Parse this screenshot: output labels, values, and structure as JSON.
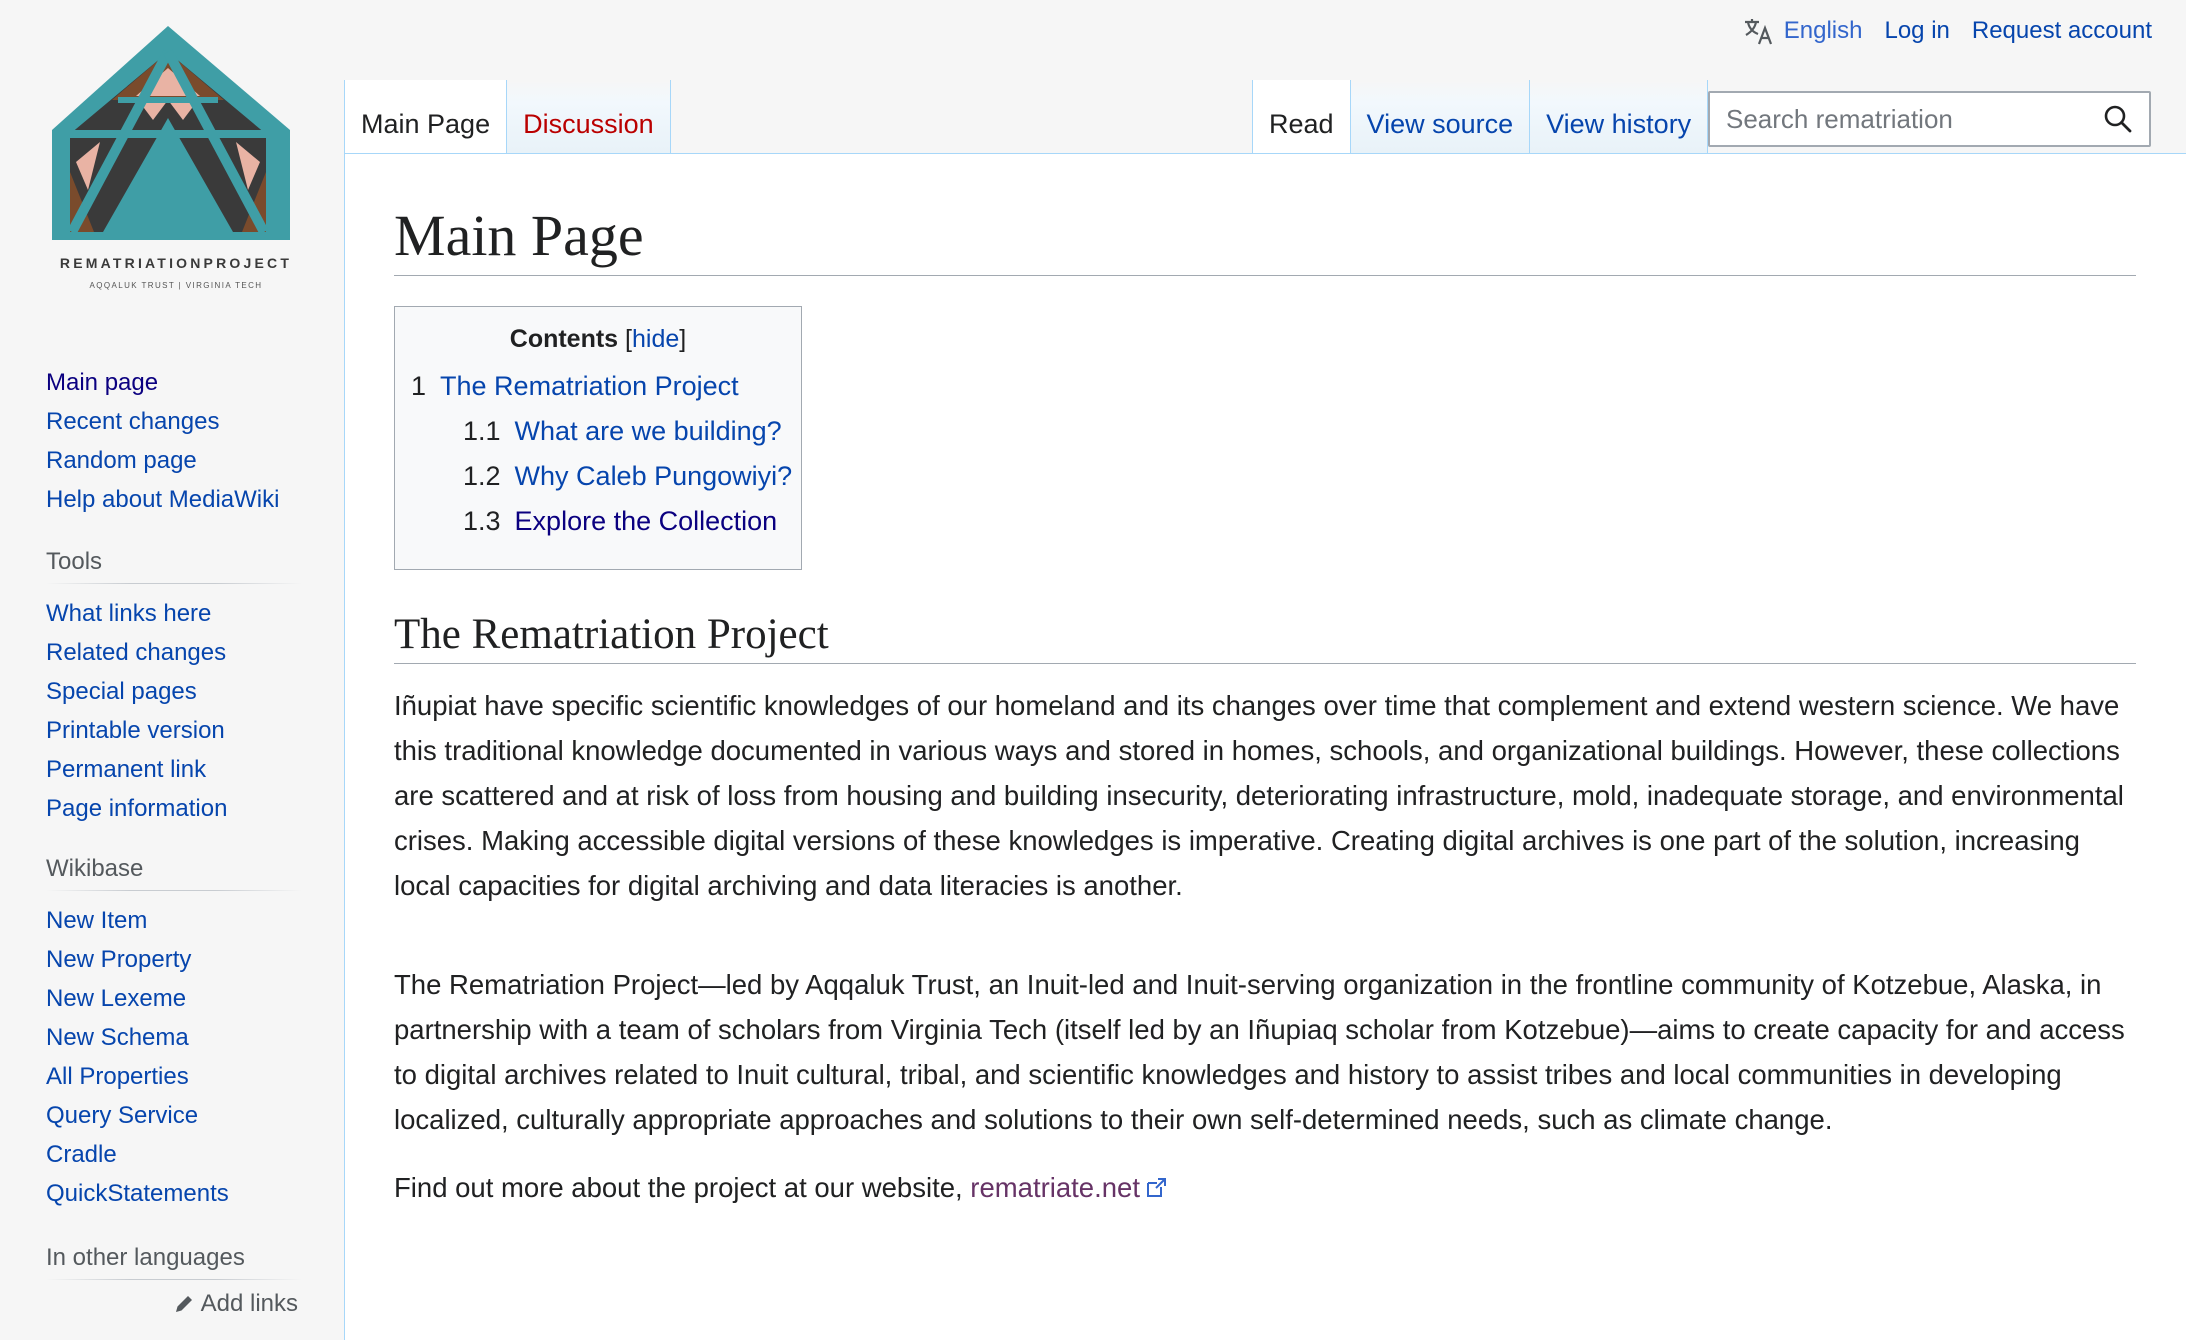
{
  "logo": {
    "wordmark": "REMATRIATIONPROJECT",
    "tagline": "AQQALUK TRUST | VIRGINIA TECH"
  },
  "personal": {
    "language": "English",
    "login": "Log in",
    "request_account": "Request account"
  },
  "tabs": {
    "left": [
      "Main Page",
      "Discussion"
    ],
    "right": [
      "Read",
      "View source",
      "View history"
    ]
  },
  "search": {
    "placeholder": "Search rematriation"
  },
  "sidebar": {
    "navigation": [
      "Main page",
      "Recent changes",
      "Random page",
      "Help about MediaWiki"
    ],
    "tools_heading": "Tools",
    "tools": [
      "What links here",
      "Related changes",
      "Special pages",
      "Printable version",
      "Permanent link",
      "Page information"
    ],
    "wikibase_heading": "Wikibase",
    "wikibase": [
      "New Item",
      "New Property",
      "New Lexeme",
      "New Schema",
      "All Properties",
      "Query Service",
      "Cradle",
      "QuickStatements"
    ],
    "languages_heading": "In other languages",
    "add_links": "Add links"
  },
  "page": {
    "title": "Main Page",
    "toc": {
      "title": "Contents",
      "toggle": "hide",
      "items": [
        {
          "num": "1",
          "label": "The Rematriation Project"
        },
        {
          "num": "1.1",
          "label": "What are we building?"
        },
        {
          "num": "1.2",
          "label": "Why Caleb Pungowiyi?"
        },
        {
          "num": "1.3",
          "label": "Explore the Collection"
        }
      ]
    },
    "section_heading": "The Rematriation Project",
    "paragraph1": "Iñupiat have specific scientific knowledges of our homeland and its changes over time that complement and extend western science. We have this traditional knowledge documented in various ways and stored in homes, schools, and organizational buildings. However, these collections are scattered and at risk of loss from housing and building insecurity, deteriorating infrastructure, mold, inadequate storage, and environmental crises. Making accessible digital versions of these knowledges is imperative. Creating digital archives is one part of the solution, increasing local capacities for digital archiving and data literacies is another.",
    "paragraph2": "The Rematriation Project—led by Aqqaluk Trust, an Inuit-led and Inuit-serving organization in the frontline community of Kotzebue, Alaska, in partnership with a team of scholars from Virginia Tech (itself led by an Iñupiaq scholar from Kotzebue)—aims to create capacity for and access to digital archives related to Inuit cultural, tribal, and scientific knowledges and history to assist tribes and local communities in developing localized, culturally appropriate approaches and solutions to their own self-determined needs, such as climate change.",
    "paragraph3_text": "Find out more about the project at our website, ",
    "paragraph3_link": "rematriate.net"
  },
  "colors": {
    "link": "#0645ad",
    "visited": "#0b0080",
    "new_link": "#ba0000",
    "external_visited": "#663366",
    "logo_teal": "#3f9ea6",
    "logo_dark": "#3a3a3a",
    "logo_pink": "#e9b3a4",
    "logo_brown": "#7a4b2c"
  }
}
